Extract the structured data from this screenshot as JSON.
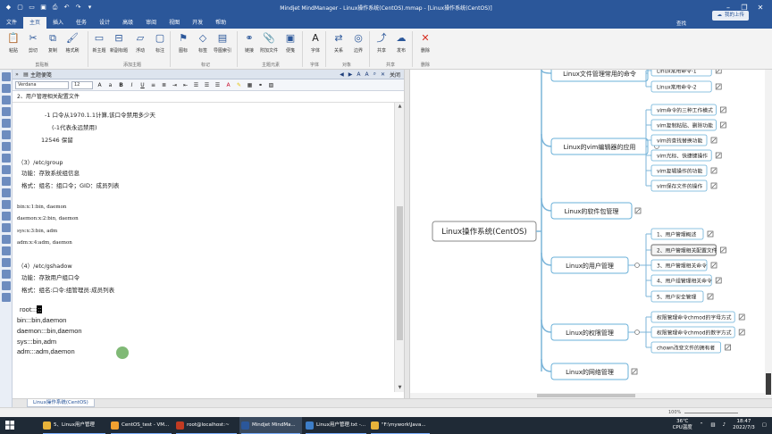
{
  "window": {
    "title": "Mindjet MindManager - Linux操作系统(CentOS).mmap - [Linux操作系统(CentOS)]",
    "controls": [
      "minimize",
      "restore",
      "close"
    ]
  },
  "menubar": {
    "items": [
      "文件",
      "主页",
      "插入",
      "任务",
      "设计",
      "高级",
      "审阅",
      "视图",
      "开发",
      "帮助"
    ],
    "active_index": 1,
    "cloud_button": "我的上传",
    "find_label": "查找"
  },
  "ribbon": {
    "buttons": [
      {
        "label": "粘贴",
        "icon": "paste-icon"
      },
      {
        "label": "剪切",
        "icon": "cut-icon"
      },
      {
        "label": "复制",
        "icon": "copy-icon"
      },
      {
        "label": "格式刷",
        "icon": "format-painter-icon"
      },
      {
        "label": "新主题",
        "icon": "new-topic-icon"
      },
      {
        "label": "新副标题",
        "icon": "subtopic-icon"
      },
      {
        "label": "浮动",
        "icon": "floating-topic-icon"
      },
      {
        "label": "标注",
        "icon": "callout-icon"
      },
      {
        "label": "图标",
        "icon": "icons-icon"
      },
      {
        "label": "标签",
        "icon": "tags-icon"
      },
      {
        "label": "导图索引",
        "icon": "map-index-icon"
      },
      {
        "label": "链接",
        "icon": "link-icon"
      },
      {
        "label": "附加文件",
        "icon": "attachment-icon"
      },
      {
        "label": "便笺",
        "icon": "notes-icon"
      },
      {
        "label": "字体",
        "icon": "font-icon"
      },
      {
        "label": "关系",
        "icon": "relationship-icon"
      },
      {
        "label": "边界",
        "icon": "boundary-icon"
      },
      {
        "label": "共享",
        "icon": "share-icon"
      },
      {
        "label": "发布",
        "icon": "publish-icon"
      },
      {
        "label": "删除",
        "icon": "delete-icon"
      }
    ],
    "groups": [
      "剪贴板",
      "添加主题",
      "标记",
      "主题元素",
      "字体",
      "对象",
      "共享",
      "删除"
    ]
  },
  "notes_panel": {
    "header_title": "主题便笺",
    "close_label": "关闭",
    "font_name": "Verdana",
    "font_size": "12",
    "topic_title": "2、用户管理相关配置文件",
    "lines": [
      {
        "text": "-1      口令从1970.1.1计算,该口令禁用多少天",
        "style": "cn"
      },
      {
        "text": "(-1代表永远禁用)",
        "style": "cn"
      },
      {
        "text": "12546     保留",
        "style": "cn"
      },
      {
        "text": "（3）/etc/group",
        "style": "cn"
      },
      {
        "text": "功能：存放系统组信息",
        "style": "cn"
      },
      {
        "text": "格式：组名：组口令；GID：成员列表",
        "style": "cn"
      },
      {
        "text": "bin:x:1:bin, daemon",
        "style": "mono"
      },
      {
        "text": "daemon:x:2:bin, daemon",
        "style": "mono"
      },
      {
        "text": "sys:x:3:bin, adm",
        "style": "mono"
      },
      {
        "text": "adm:x:4:adm, daemon",
        "style": "mono"
      },
      {
        "text": "（4）/etc/gshadow",
        "style": "cn"
      },
      {
        "text": "功能：存放用户组口令",
        "style": "cn"
      },
      {
        "text": "格式：组名:口令:组管理员:成员列表",
        "style": "cn"
      },
      {
        "text": "root:::",
        "style": "big"
      },
      {
        "text": "bin:::bin,daemon",
        "style": "big"
      },
      {
        "text": "daemon:::bin,daemon",
        "style": "big"
      },
      {
        "text": "sys:::bin,adm",
        "style": "big"
      },
      {
        "text": "adm:::adm,daemon",
        "style": "big"
      }
    ]
  },
  "mindmap": {
    "central": "Linux操作系统(CentOS)",
    "branches": [
      {
        "label": "Linux文件管理常用的命令",
        "children": [
          "Linux常用命令-1",
          "Linux常用命令-2"
        ]
      },
      {
        "label": "Linux的vim编辑器的应用",
        "children": [
          "vim命令的三种工作模式",
          "vim复制粘贴、删除功能",
          "vim的查找替换功能",
          "vim光标、快捷键操作",
          "vim复辑操作的功能",
          "vim保存文件的操作"
        ]
      },
      {
        "label": "Linux的软件包管理",
        "children": []
      },
      {
        "label": "Linux的用户管理",
        "children": [
          "1、用户管理概述",
          "2、用户管理相关配置文件",
          "3、用户管理相关命令",
          "4、用户组管理相关命令",
          "5、用户安全管理"
        ],
        "selected_child": 1
      },
      {
        "label": "Linux的权限管理",
        "children": [
          "权限管理命令chmod的字母方式",
          "权限管理命令chmod的数字方式",
          "chown改变文件的拥有者"
        ]
      },
      {
        "label": "Linux的网络管理",
        "children": []
      }
    ]
  },
  "document_tab": "Linux操作系统(CentOS)",
  "statusbar": {
    "zoom": "100%"
  },
  "taskbar": {
    "items": [
      {
        "label": "5、Linux用户管理",
        "color": "#e8b33a"
      },
      {
        "label": "CentOS_test - VM...",
        "color": "#f0a030"
      },
      {
        "label": "root@localhost:~",
        "color": "#c23b22"
      },
      {
        "label": "Mindjet MindMa...",
        "color": "#2b579a"
      },
      {
        "label": "Linux用户管理.txt -...",
        "color": "#3d7ec8"
      },
      {
        "label": "\"F:\\mywork\\Java...",
        "color": "#e8b33a"
      }
    ],
    "active_index": 3,
    "weather": "36℃",
    "weather_label": "CPU温度",
    "time": "18:47",
    "date": "2022/7/3"
  },
  "colors": {
    "accent": "#2b579a",
    "branch_border": "#7cb5d9",
    "node_border": "#6ab0d8"
  }
}
